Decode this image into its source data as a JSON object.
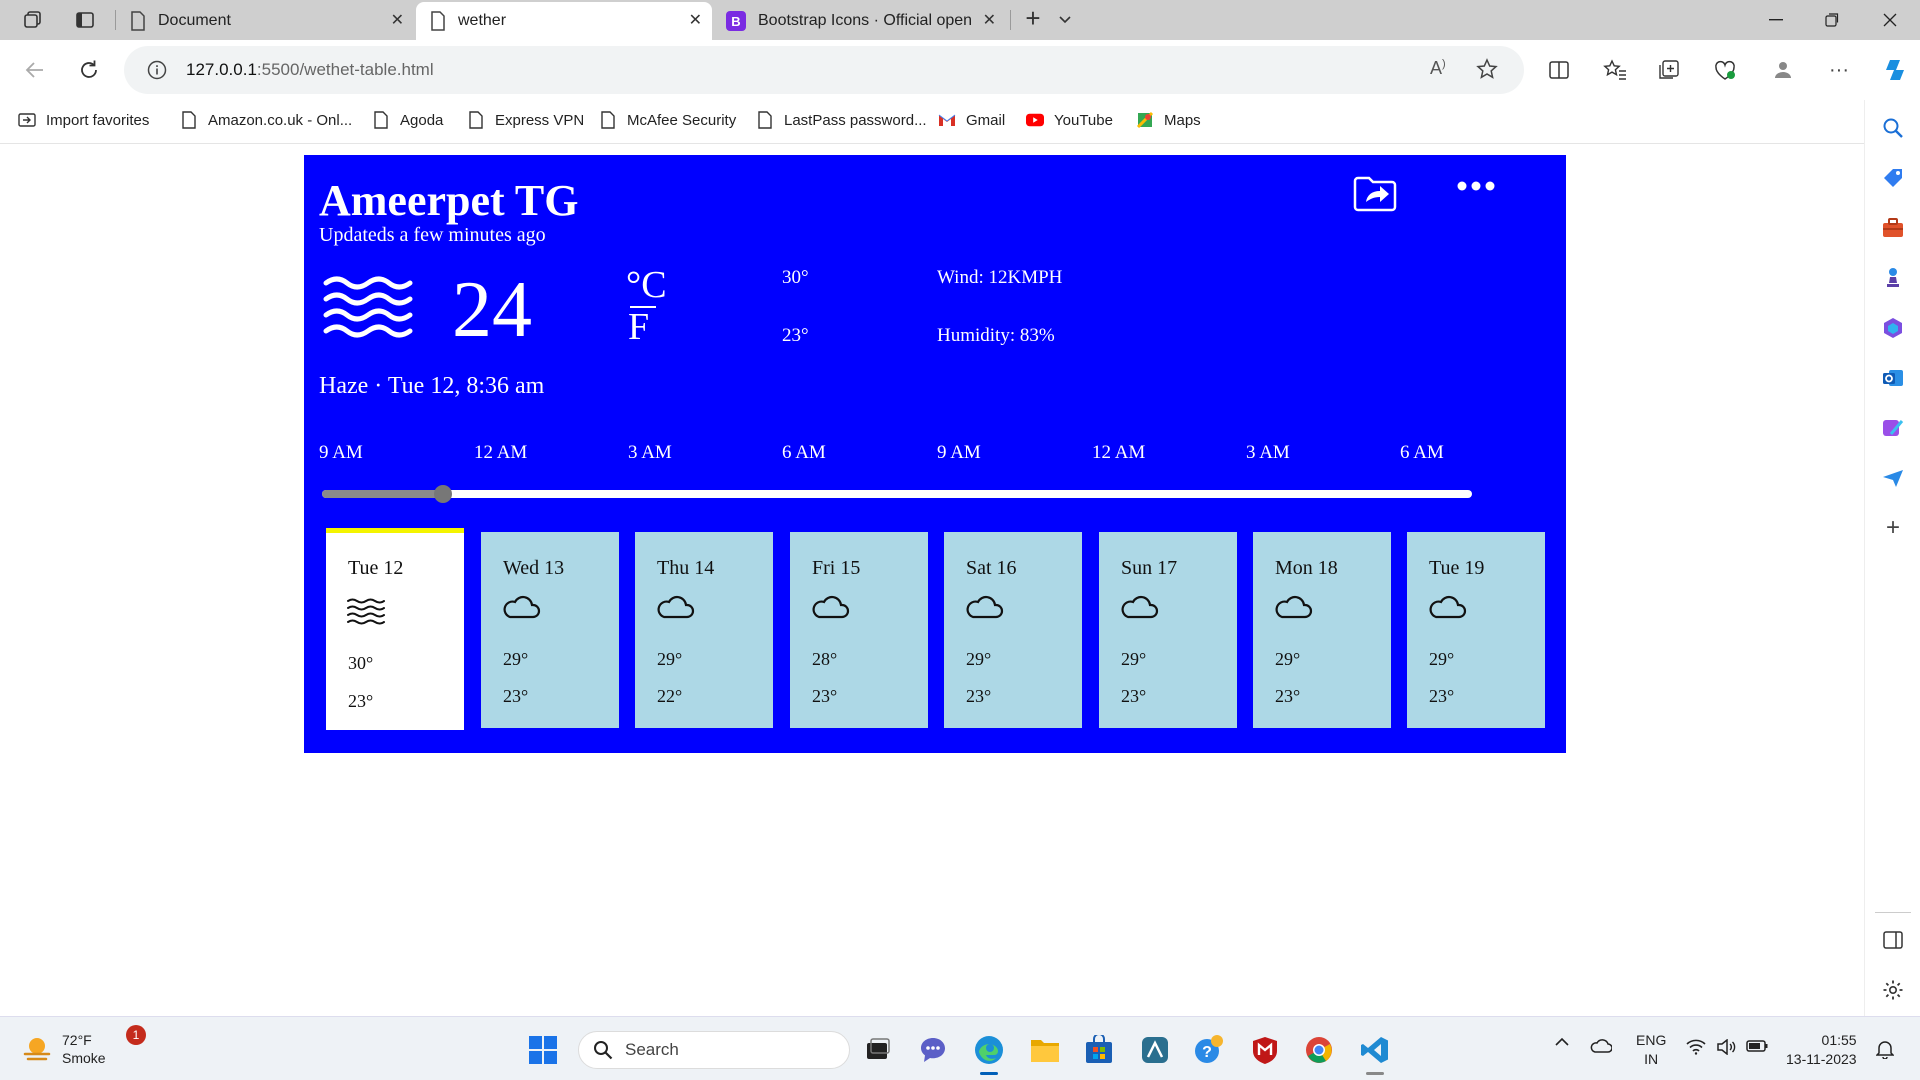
{
  "browser": {
    "tabs": [
      {
        "title": "Document",
        "active": false
      },
      {
        "title": "wether",
        "active": true
      },
      {
        "title": "Bootstrap Icons · Official open sc",
        "active": false
      }
    ],
    "new_tab_symbol": "+",
    "url_host": "127.0.0.1",
    "url_rest": ":5500/wethet-table.html",
    "favorites": [
      {
        "label": "Import favorites",
        "icon": "import-icon"
      },
      {
        "label": "Amazon.co.uk - Onl...",
        "icon": "page-icon"
      },
      {
        "label": "Agoda",
        "icon": "page-icon"
      },
      {
        "label": "Express VPN",
        "icon": "page-icon"
      },
      {
        "label": "McAfee Security",
        "icon": "page-icon"
      },
      {
        "label": "LastPass password...",
        "icon": "page-icon"
      },
      {
        "label": "Gmail",
        "icon": "gmail-icon"
      },
      {
        "label": "YouTube",
        "icon": "youtube-icon"
      },
      {
        "label": "Maps",
        "icon": "maps-icon"
      }
    ]
  },
  "weather": {
    "city": "Ameerpet TG",
    "updated": "Updateds a few minutes ago",
    "temperature": "24",
    "unit_c": "°C",
    "unit_f": "F",
    "high": "30°",
    "low": "23°",
    "wind": "Wind: 12KMPH",
    "humidity": "Humidity: 83%",
    "description": "Haze · Tue 12, 8:36 am",
    "condition_icon": "haze-icon",
    "hours": [
      "9 AM",
      "12 AM",
      "3 AM",
      "6 AM",
      "9 AM",
      "12 AM",
      "3 AM",
      "6 AM"
    ],
    "slider_fraction": 0.105,
    "days": [
      {
        "name": "Tue 12",
        "high": "30°",
        "low": "23°",
        "icon": "haze-icon",
        "selected": true
      },
      {
        "name": "Wed 13",
        "high": "29°",
        "low": "23°",
        "icon": "cloud-icon",
        "selected": false
      },
      {
        "name": "Thu 14",
        "high": "29°",
        "low": "22°",
        "icon": "cloud-icon",
        "selected": false
      },
      {
        "name": "Fri 15",
        "high": "28°",
        "low": "23°",
        "icon": "cloud-icon",
        "selected": false
      },
      {
        "name": "Sat 16",
        "high": "29°",
        "low": "23°",
        "icon": "cloud-icon",
        "selected": false
      },
      {
        "name": "Sun 17",
        "high": "29°",
        "low": "23°",
        "icon": "cloud-icon",
        "selected": false
      },
      {
        "name": "Mon 18",
        "high": "29°",
        "low": "23°",
        "icon": "cloud-icon",
        "selected": false
      },
      {
        "name": "Tue 19",
        "high": "29°",
        "low": "23°",
        "icon": "cloud-icon",
        "selected": false
      }
    ],
    "colors": {
      "background": "#0000ff",
      "card": "#add8e6",
      "selected_card": "#ffffff",
      "selected_marker": "#f4f400"
    }
  },
  "taskbar": {
    "weather_temp": "72°F",
    "weather_desc": "Smoke",
    "notification_count": "1",
    "search_label": "Search",
    "lang_line1": "ENG",
    "lang_line2": "IN",
    "time": "01:55",
    "date": "13-11-2023"
  }
}
